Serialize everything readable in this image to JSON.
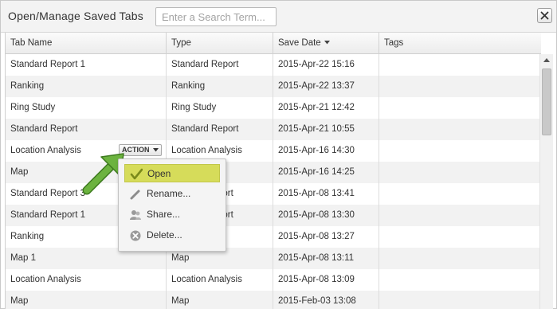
{
  "dialog": {
    "title": "Open/Manage Saved Tabs",
    "search_placeholder": "Enter a Search Term..."
  },
  "columns": {
    "tab_name": "Tab Name",
    "type": "Type",
    "save_date": "Save Date",
    "tags": "Tags"
  },
  "rows": [
    {
      "name": "Standard Report 1",
      "type": "Standard Report",
      "date": "2015-Apr-22 15:16"
    },
    {
      "name": "Ranking",
      "type": "Ranking",
      "date": "2015-Apr-22 13:37"
    },
    {
      "name": "Ring Study",
      "type": "Ring Study",
      "date": "2015-Apr-21 12:42"
    },
    {
      "name": "Standard Report",
      "type": "Standard Report",
      "date": "2015-Apr-21 10:55"
    },
    {
      "name": "Location Analysis",
      "type": "Location Analysis",
      "date": "2015-Apr-16 14:30"
    },
    {
      "name": "Map",
      "type": "",
      "date": "2015-Apr-16 14:25"
    },
    {
      "name": "Standard Report 3",
      "type": "port",
      "date": "2015-Apr-08 13:41"
    },
    {
      "name": "Standard Report 1",
      "type": "port",
      "date": "2015-Apr-08 13:30"
    },
    {
      "name": "Ranking",
      "type": "",
      "date": "2015-Apr-08 13:27"
    },
    {
      "name": "Map 1",
      "type": "Map",
      "date": "2015-Apr-08 13:11"
    },
    {
      "name": "Location Analysis",
      "type": "Location Analysis",
      "date": "2015-Apr-08 13:09"
    },
    {
      "name": "Map",
      "type": "Map",
      "date": "2015-Feb-03 13:08"
    }
  ],
  "action_button": "ACTION",
  "context_menu": {
    "open": "Open",
    "rename": "Rename...",
    "share": "Share...",
    "delete": "Delete..."
  },
  "colors": {
    "highlight": "#d6dc5a",
    "pointer_arrow": "#6cb33f"
  }
}
